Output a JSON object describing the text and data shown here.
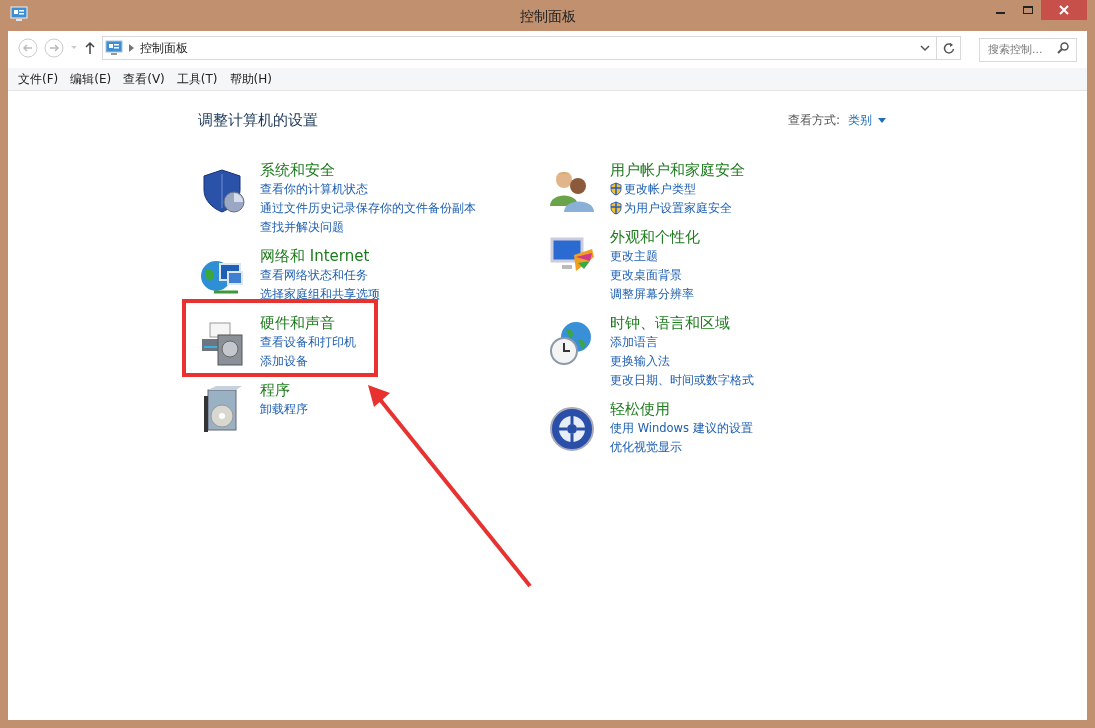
{
  "window": {
    "title": "控制面板"
  },
  "address_bar": {
    "path": [
      "控制面板"
    ],
    "search_placeholder": "搜索控制..."
  },
  "menu": [
    "文件(F)",
    "编辑(E)",
    "查看(V)",
    "工具(T)",
    "帮助(H)"
  ],
  "heading": "调整计算机的设置",
  "view_by": {
    "label": "查看方式:",
    "value": "类别"
  },
  "columns": [
    [
      {
        "title": "系统和安全",
        "highlighted": false,
        "links": [
          {
            "kind": "plain",
            "text": "查看你的计算机状态"
          },
          {
            "kind": "plain",
            "text": "通过文件历史记录保存你的文件备份副本"
          },
          {
            "kind": "plain",
            "text": "查找并解决问题"
          }
        ]
      },
      {
        "title": "网络和 Internet",
        "highlighted": false,
        "links": [
          {
            "kind": "plain",
            "text": "查看网络状态和任务"
          },
          {
            "kind": "plain",
            "text": "选择家庭组和共享选项"
          }
        ]
      },
      {
        "title": "硬件和声音",
        "highlighted": true,
        "links": [
          {
            "kind": "plain",
            "text": "查看设备和打印机"
          },
          {
            "kind": "plain",
            "text": "添加设备"
          }
        ]
      },
      {
        "title": "程序",
        "highlighted": false,
        "links": [
          {
            "kind": "plain",
            "text": "卸载程序"
          }
        ]
      }
    ],
    [
      {
        "title": "用户帐户和家庭安全",
        "highlighted": false,
        "links": [
          {
            "kind": "shield",
            "text": "更改帐户类型"
          },
          {
            "kind": "shield",
            "text": "为用户设置家庭安全"
          }
        ]
      },
      {
        "title": "外观和个性化",
        "highlighted": false,
        "links": [
          {
            "kind": "plain",
            "text": "更改主题"
          },
          {
            "kind": "plain",
            "text": "更改桌面背景"
          },
          {
            "kind": "plain",
            "text": "调整屏幕分辨率"
          }
        ]
      },
      {
        "title": "时钟、语言和区域",
        "highlighted": false,
        "links": [
          {
            "kind": "plain",
            "text": "添加语言"
          },
          {
            "kind": "plain",
            "text": "更换输入法"
          },
          {
            "kind": "plain",
            "text": "更改日期、时间或数字格式"
          }
        ]
      },
      {
        "title": "轻松使用",
        "highlighted": false,
        "links": [
          {
            "kind": "plain",
            "text": "使用 Windows 建议的设置"
          },
          {
            "kind": "plain",
            "text": "优化视觉显示"
          }
        ]
      }
    ]
  ]
}
